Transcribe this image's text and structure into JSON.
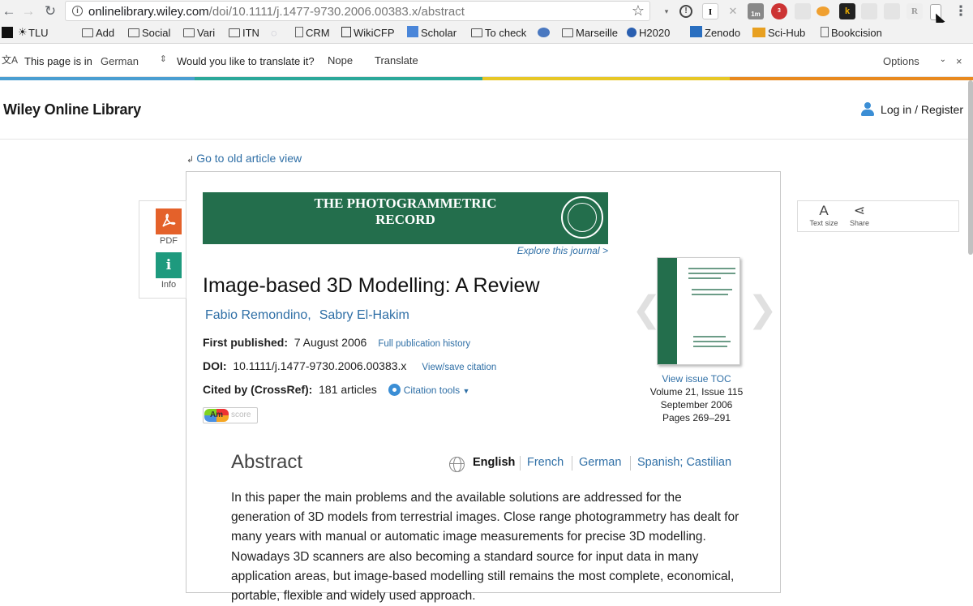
{
  "browser": {
    "url_host": "onlinelibrary.wiley.com",
    "url_path": "/doi/10.1111/j.1477-9730.2006.00383.x/abstract",
    "ext_abp_badge": "3",
    "ext_1m_badge": "1m"
  },
  "bookmarks": [
    {
      "label": "TLU",
      "icon": "facebook-icon"
    },
    {
      "label": "Add",
      "icon": "folder-icon"
    },
    {
      "label": "Social",
      "icon": "folder-icon"
    },
    {
      "label": "Vari",
      "icon": "folder-icon"
    },
    {
      "label": "ITN",
      "icon": "folder-icon"
    },
    {
      "label": "CRM",
      "icon": "page-icon"
    },
    {
      "label": "WikiCFP",
      "icon": "wikicfp-icon"
    },
    {
      "label": "Scholar",
      "icon": "scholar-icon"
    },
    {
      "label": "To check",
      "icon": "folder-icon"
    },
    {
      "label": "Marseille",
      "icon": "folder-icon"
    },
    {
      "label": "H2020",
      "icon": "h2020-icon"
    },
    {
      "label": "Zenodo",
      "icon": "zenodo-icon"
    },
    {
      "label": "Sci-Hub",
      "icon": "scihub-icon"
    },
    {
      "label": "Bookcision",
      "icon": "page-icon"
    }
  ],
  "translate_bar": {
    "prefix": "This page is in",
    "language": "German",
    "question": "Would you like to translate it?",
    "nope": "Nope",
    "translate": "Translate",
    "options": "Options"
  },
  "site": {
    "logo": "Wiley Online Library",
    "login": "Log in / Register"
  },
  "article": {
    "old_view": "Go to old article view",
    "journal_banner": "THE PHOTOGRAMMETRIC RECORD",
    "explore": "Explore this journal >",
    "title": "Image-based 3D Modelling: A Review",
    "authors": [
      "Fabio Remondino,",
      "Sabry El-Hakim"
    ],
    "first_published_label": "First published:",
    "first_published_value": "7 August 2006",
    "pub_history": "Full publication history",
    "doi_label": "DOI:",
    "doi_value": "10.1111/j.1477-9730.2006.00383.x",
    "view_citation": "View/save citation",
    "cited_label": "Cited by (CrossRef):",
    "cited_value": "181 articles",
    "citation_tools": "Citation tools",
    "altmetric_am": "Am",
    "altmetric_score": "score"
  },
  "side_tools": {
    "pdf": "PDF",
    "info": "Info",
    "info_glyph": "i"
  },
  "right_tools": {
    "text_size": "Text size",
    "share": "Share"
  },
  "issue": {
    "view_toc": "View  issue TOC",
    "volume": "Volume 21, Issue 115",
    "date": "September 2006",
    "pages": "Pages 269–291"
  },
  "abstract": {
    "heading": "Abstract",
    "languages": [
      "English",
      "French",
      "German",
      "Spanish; Castilian"
    ],
    "active_language": "English",
    "text": "In this paper the main problems and the available solutions are addressed for the generation of 3D models from terrestrial images. Close range photogrammetry has dealt for many years with manual or automatic image measurements for precise 3D modelling. Nowadays 3D scanners are also becoming a standard source for input data in many application areas, but image-based modelling still remains the most complete, economical, portable, flexible and widely used approach."
  },
  "colors": {
    "link": "#2f6fa6",
    "journal_green": "#236e4c",
    "pdf_orange": "#e4612a",
    "info_teal": "#1e9a7e"
  }
}
